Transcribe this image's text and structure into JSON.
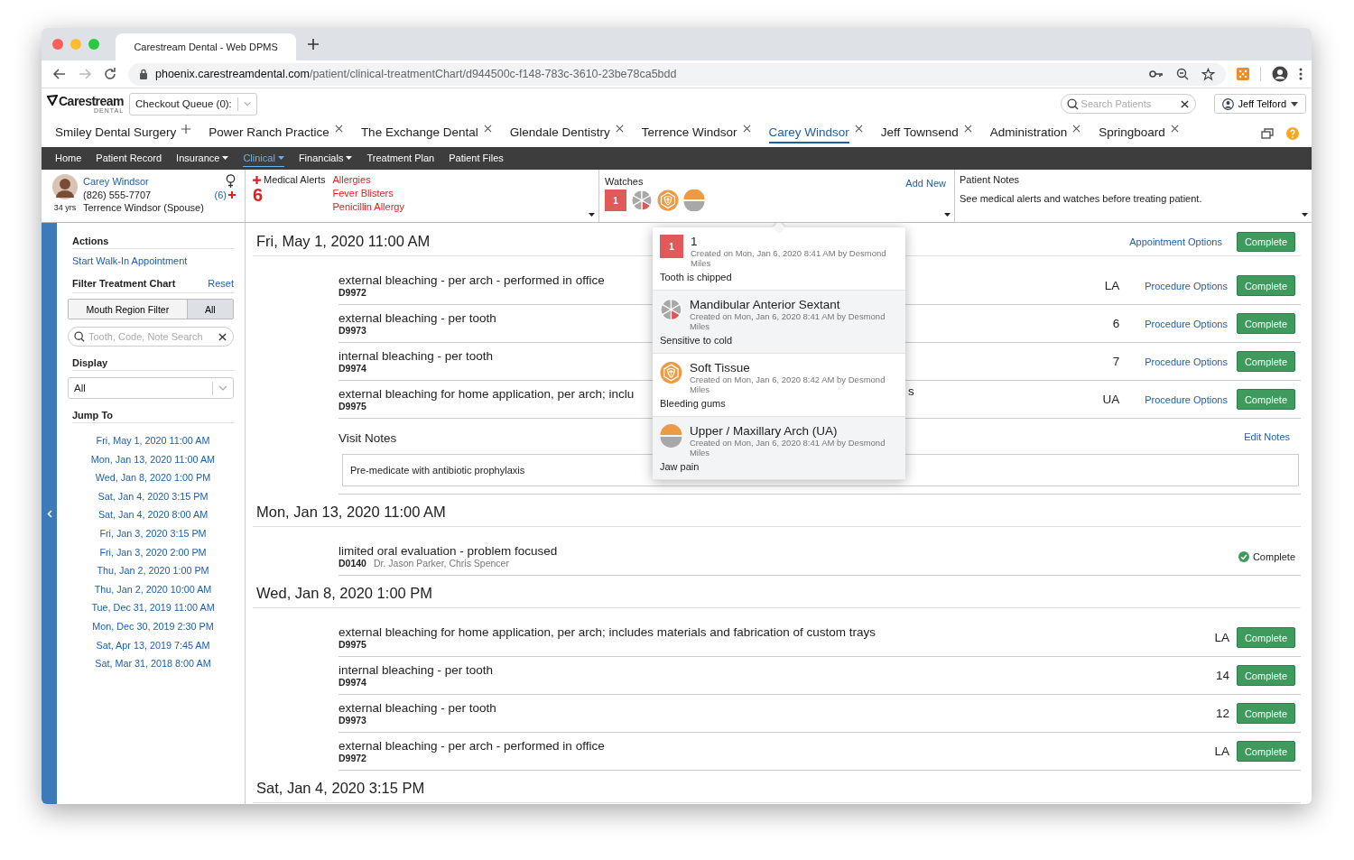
{
  "browser": {
    "tab_title": "Carestream Dental - Web DPMS",
    "url_host": "phoenix.carestreamdental.com",
    "url_path": "/patient/clinical-treatmentChart/d944500c-f148-783c-3610-23be78ca5bdd"
  },
  "app_header": {
    "logo": "Carestream",
    "logo_sub": "DENTAL",
    "checkout_queue": "Checkout Queue (0):",
    "search_placeholder": "Search Patients",
    "user": "Jeff Telford"
  },
  "patient_tabs": [
    {
      "label": "Smiley Dental Surgery",
      "selected": false,
      "kind": "add"
    },
    {
      "label": "Power Ranch Practice",
      "selected": false,
      "kind": "close"
    },
    {
      "label": "The Exchange Dental",
      "selected": false,
      "kind": "close"
    },
    {
      "label": "Glendale Dentistry",
      "selected": false,
      "kind": "close"
    },
    {
      "label": "Terrence Windsor",
      "selected": false,
      "kind": "close"
    },
    {
      "label": "Carey Windsor",
      "selected": true,
      "kind": "close"
    },
    {
      "label": "Jeff Townsend",
      "selected": false,
      "kind": "close"
    },
    {
      "label": "Administration",
      "selected": false,
      "kind": "close"
    },
    {
      "label": "Springboard",
      "selected": false,
      "kind": "close"
    }
  ],
  "nav": [
    {
      "label": "Home",
      "selected": false,
      "dropdown": false
    },
    {
      "label": "Patient Record",
      "selected": false,
      "dropdown": false
    },
    {
      "label": "Insurance",
      "selected": false,
      "dropdown": true
    },
    {
      "label": "Clinical",
      "selected": true,
      "dropdown": true
    },
    {
      "label": "Financials",
      "selected": false,
      "dropdown": true
    },
    {
      "label": "Treatment Plan",
      "selected": false,
      "dropdown": false
    },
    {
      "label": "Patient Files",
      "selected": false,
      "dropdown": false
    }
  ],
  "patient": {
    "name": "Carey Windsor",
    "phone": "(826) 555-7707",
    "age": "34 yrs",
    "relation": "Terrence Windsor (Spouse)",
    "alert_count": "(6)"
  },
  "medical_alerts": {
    "title": "Medical Alerts",
    "count": "6",
    "items": [
      "Allergies",
      "Fever Blisters",
      "Penicillin Allergy"
    ]
  },
  "watches": {
    "title": "Watches",
    "add_new": "Add New",
    "items": [
      {
        "kind": "number",
        "badge": "1"
      },
      {
        "kind": "sextant"
      },
      {
        "kind": "tissue"
      },
      {
        "kind": "arch"
      }
    ]
  },
  "patient_notes": {
    "title": "Patient Notes",
    "text": "See medical alerts and watches before treating patient."
  },
  "sidebar": {
    "actions_title": "Actions",
    "walk_in": "Start Walk-In Appointment",
    "filter_title": "Filter Treatment Chart",
    "reset": "Reset",
    "segments": [
      {
        "label": "Mouth Region Filter",
        "selected": false
      },
      {
        "label": "All",
        "selected": true
      }
    ],
    "search_placeholder": "Tooth, Code, Note Search",
    "display_title": "Display",
    "display_value": "All",
    "jump_title": "Jump To",
    "jump_dates": [
      "Fri, May 1, 2020 11:00 AM",
      "Mon, Jan 13, 2020 11:00 AM",
      "Wed, Jan 8, 2020 1:00 PM",
      "Sat, Jan 4, 2020 3:15 PM",
      "Sat, Jan 4, 2020 8:00 AM",
      "Fri, Jan 3, 2020 3:15 PM",
      "Fri, Jan 3, 2020 2:00 PM",
      "Thu, Jan 2, 2020 1:00 PM",
      "Thu, Jan 2, 2020 10:00 AM",
      "Tue, Dec 31, 2019 11:00 AM",
      "Mon, Dec 30, 2019 2:30 PM",
      "Sat, Apr 13, 2019 7:45 AM",
      "Sat, Mar 31, 2018 8:00 AM"
    ]
  },
  "appointments": [
    {
      "date": "Fri, May 1, 2020 11:00 AM",
      "options": "Appointment Options",
      "complete": "Complete",
      "procedures": [
        {
          "desc": "external bleaching - per arch - performed in office",
          "code": "D9972",
          "tooth": "LA",
          "options": "Procedure Options",
          "completed": false,
          "status_label": "Complete"
        },
        {
          "desc": "external bleaching - per tooth",
          "code": "D9973",
          "tooth": "6",
          "options": "Procedure Options",
          "completed": false,
          "status_label": "Complete"
        },
        {
          "desc": "internal bleaching - per tooth",
          "code": "D9974",
          "tooth": "7",
          "options": "Procedure Options",
          "completed": false,
          "status_label": "Complete"
        },
        {
          "desc": "external bleaching for home application, per arch; inclu",
          "tail": "s",
          "code": "D9975",
          "tooth": "UA",
          "options": "Procedure Options",
          "completed": false,
          "status_label": "Complete"
        }
      ],
      "visit_notes": {
        "title": "Visit Notes",
        "edit": "Edit Notes",
        "text": "Pre-medicate with antibiotic prophylaxis"
      }
    },
    {
      "date": "Mon, Jan 13, 2020 11:00 AM",
      "procedures": [
        {
          "desc": "limited oral evaluation - problem focused",
          "code": "D0140",
          "providers": "Dr. Jason Parker, Chris Spencer",
          "completed": true,
          "status_label": "Complete"
        }
      ]
    },
    {
      "date": "Wed, Jan 8, 2020 1:00 PM",
      "procedures": [
        {
          "desc": "external bleaching for home application, per arch; includes materials and fabrication of custom trays",
          "code": "D9975",
          "tooth": "LA",
          "completed": false,
          "status_label": "Complete"
        },
        {
          "desc": "internal bleaching - per tooth",
          "code": "D9974",
          "tooth": "14",
          "completed": false,
          "status_label": "Complete"
        },
        {
          "desc": "external bleaching - per tooth",
          "code": "D9973",
          "tooth": "12",
          "completed": false,
          "status_label": "Complete"
        },
        {
          "desc": "external bleaching - per arch - performed in office",
          "code": "D9972",
          "tooth": "LA",
          "completed": false,
          "status_label": "Complete"
        }
      ]
    },
    {
      "date": "Sat, Jan 4, 2020 3:15 PM"
    }
  ],
  "watch_popup": [
    {
      "kind": "number",
      "badge": "1",
      "title": "1",
      "meta": "Created on Mon, Jan 6, 2020 8:41 AM by Desmond Miles",
      "note": "Tooth is chipped"
    },
    {
      "kind": "sextant",
      "title": "Mandibular Anterior Sextant",
      "meta": "Created on Mon, Jan 6, 2020 8:41 AM by Desmond Miles",
      "note": "Sensitive to cold"
    },
    {
      "kind": "tissue",
      "title": "Soft Tissue",
      "meta": "Created on Mon, Jan 6, 2020 8:42 AM by Desmond Miles",
      "note": "Bleeding gums"
    },
    {
      "kind": "arch",
      "title": "Upper / Maxillary Arch (UA)",
      "meta": "Created on Mon, Jan 6, 2020 8:41 AM by Desmond Miles",
      "note": "Jaw pain"
    }
  ]
}
